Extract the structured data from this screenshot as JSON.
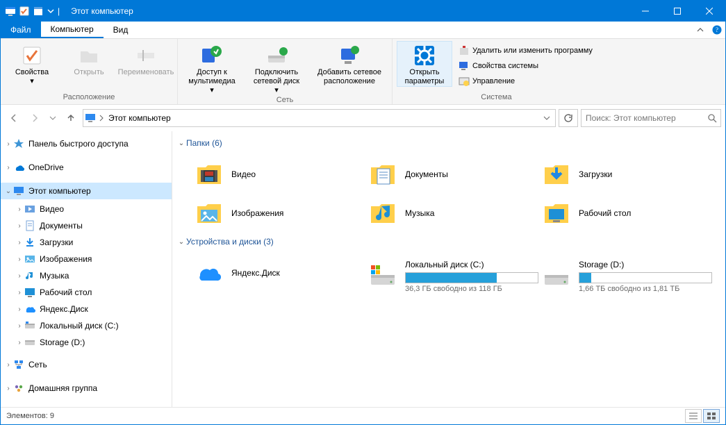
{
  "window": {
    "title": "Этот компьютер"
  },
  "tabs": {
    "file": "Файл",
    "computer": "Компьютер",
    "view": "Вид"
  },
  "ribbon": {
    "group1": {
      "caption": "Расположение",
      "properties": "Свойства",
      "open": "Открыть",
      "rename": "Переименовать"
    },
    "group2": {
      "caption": "Сеть",
      "media_l1": "Доступ к",
      "media_l2": "мультимедиа",
      "netdrive_l1": "Подключить",
      "netdrive_l2": "сетевой диск",
      "addloc_l1": "Добавить сетевое",
      "addloc_l2": "расположение"
    },
    "group3": {
      "caption": "Система",
      "settings_l1": "Открыть",
      "settings_l2": "параметры",
      "uninstall": "Удалить или изменить программу",
      "sysprops": "Свойства системы",
      "manage": "Управление"
    }
  },
  "nav": {
    "address": "Этот компьютер",
    "search_placeholder": "Поиск: Этот компьютер"
  },
  "tree": {
    "quick": "Панель быстрого доступа",
    "onedrive": "OneDrive",
    "thispc": "Этот компьютер",
    "video": "Видео",
    "documents": "Документы",
    "downloads": "Загрузки",
    "pictures": "Изображения",
    "music": "Музыка",
    "desktop": "Рабочий стол",
    "yadisk": "Яндекс.Диск",
    "cdrive": "Локальный диск (C:)",
    "ddrive": "Storage (D:)",
    "network": "Сеть",
    "homegroup": "Домашняя группа"
  },
  "content": {
    "group_folders": "Папки (6)",
    "group_drives": "Устройства и диски (3)",
    "folders": {
      "video": "Видео",
      "documents": "Документы",
      "downloads": "Загрузки",
      "pictures": "Изображения",
      "music": "Музыка",
      "desktop": "Рабочий стол"
    },
    "drives": {
      "yadisk": "Яндекс.Диск",
      "c_name": "Локальный диск (C:)",
      "c_sub": "36,3 ГБ свободно из 118 ГБ",
      "c_fill_pct": 69,
      "d_name": "Storage (D:)",
      "d_sub": "1,66 ТБ свободно из 1,81 ТБ",
      "d_fill_pct": 9
    }
  },
  "status": {
    "items": "Элементов: 9"
  }
}
